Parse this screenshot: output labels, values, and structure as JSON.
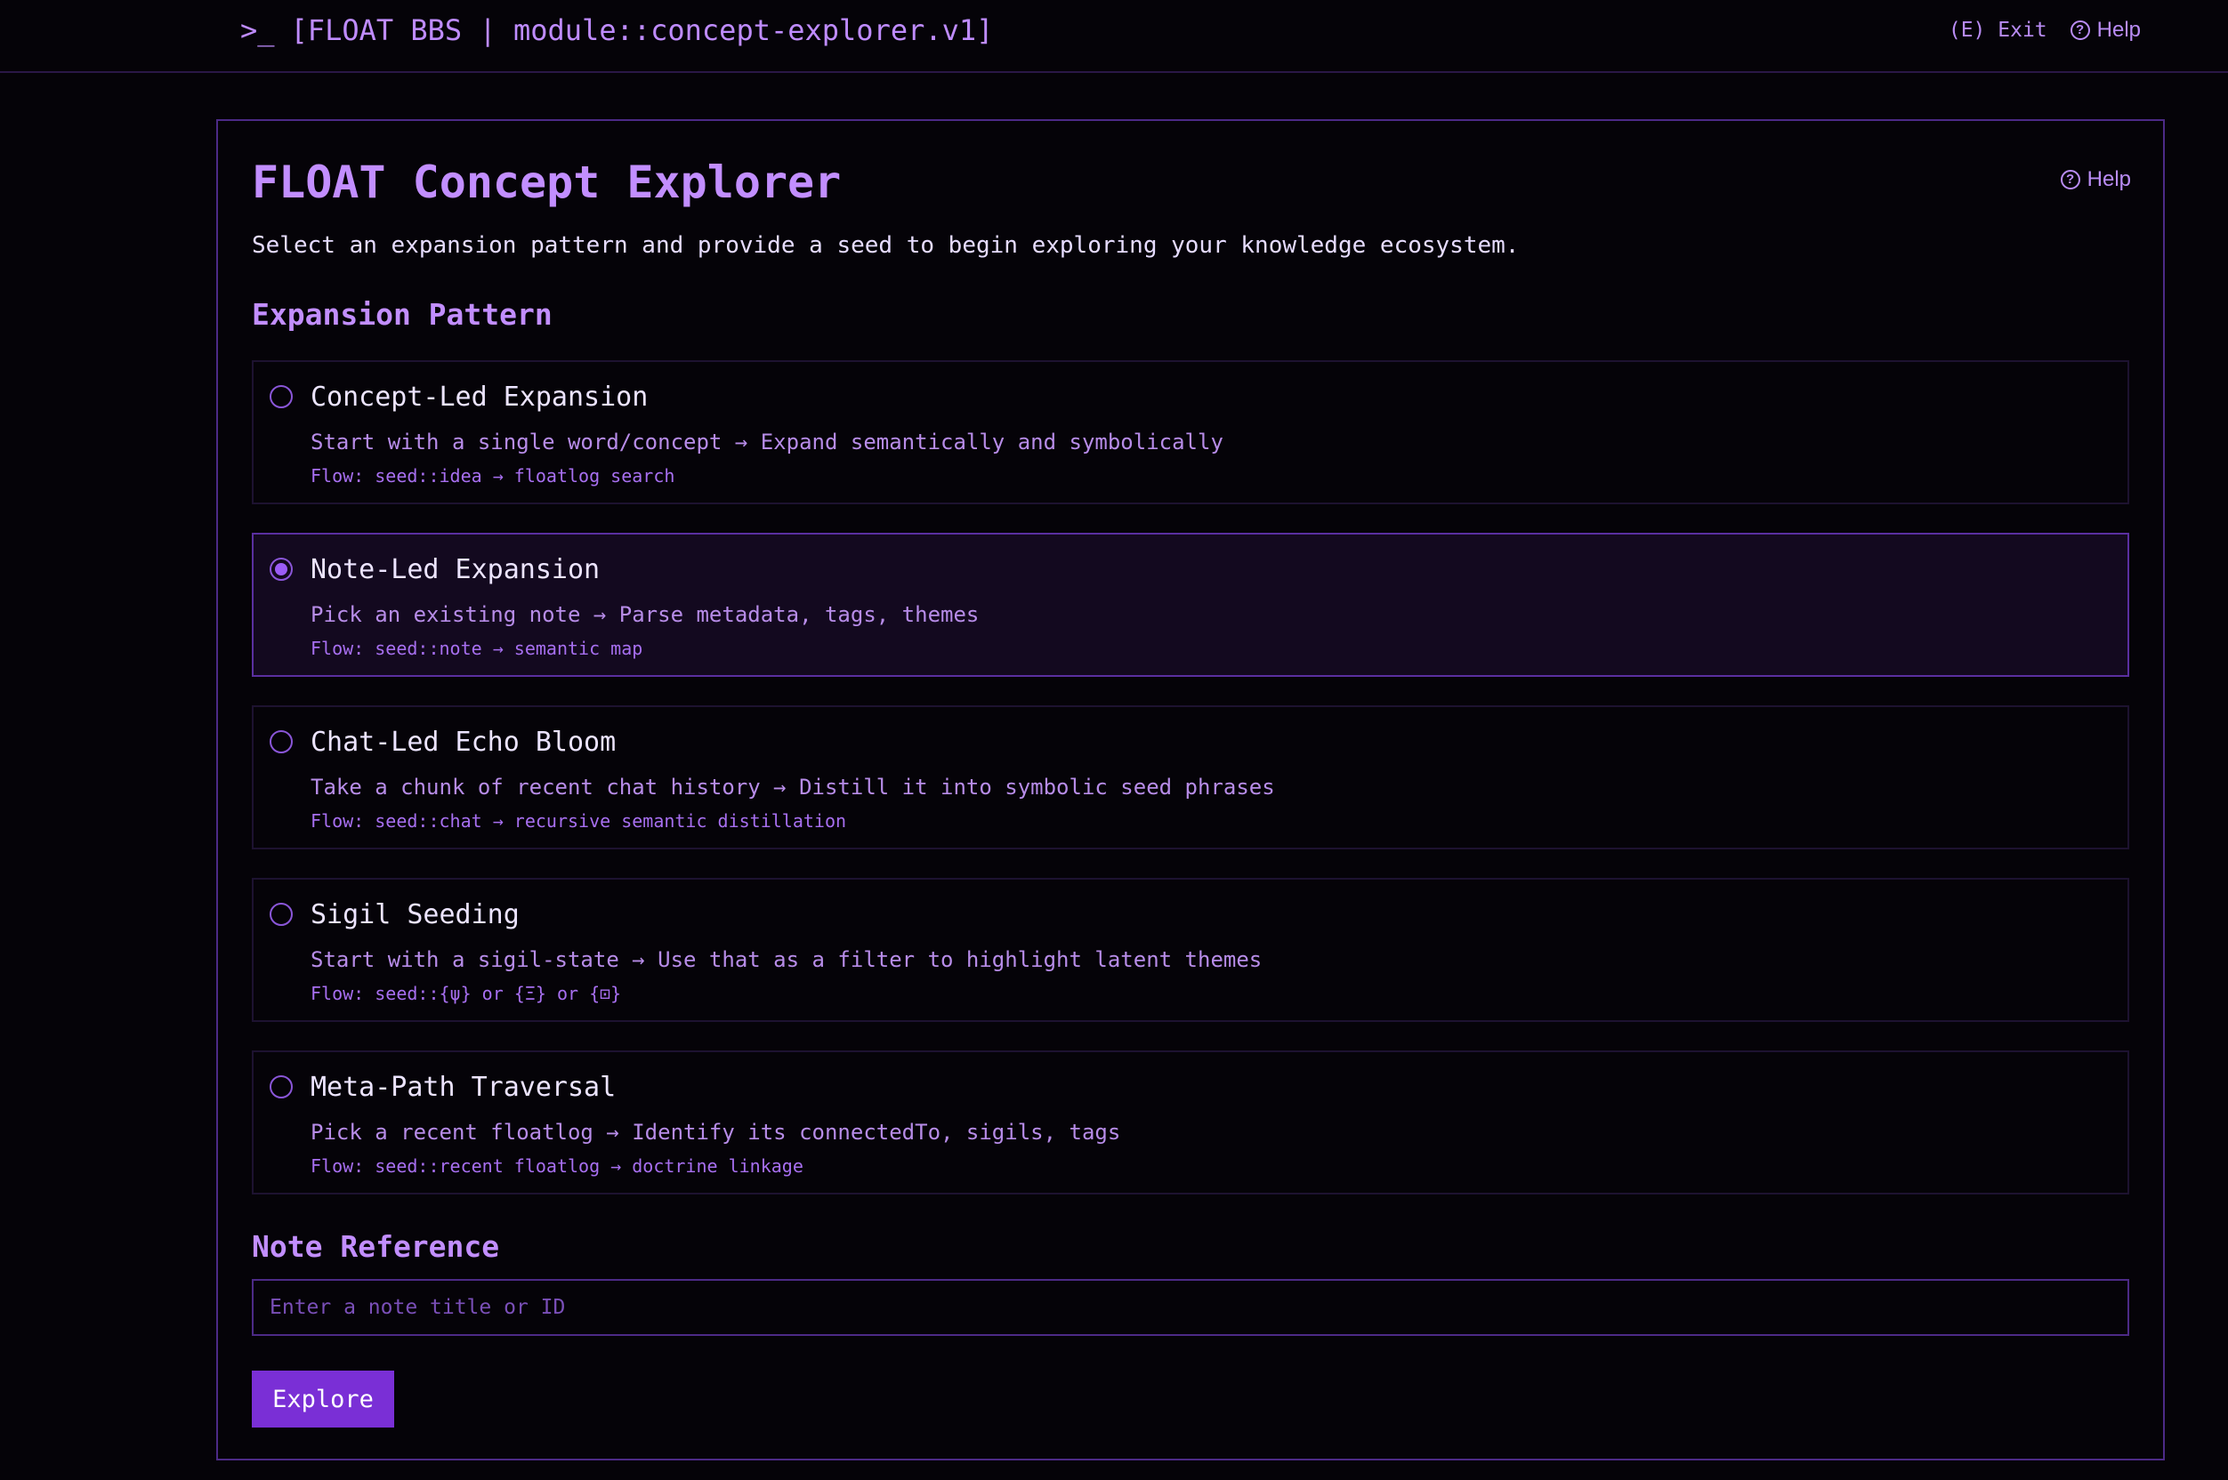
{
  "topbar": {
    "prompt": ">_",
    "title": "[FLOAT BBS | module::concept-explorer.v1]",
    "exit_label": "(E) Exit",
    "help_label": "Help"
  },
  "panel": {
    "title": "FLOAT Concept Explorer",
    "help_label": "Help",
    "subtitle": "Select an expansion pattern and provide a seed to begin exploring your knowledge ecosystem.",
    "expansion_heading": "Expansion Pattern",
    "options": [
      {
        "title": "Concept-Led Expansion",
        "description": "Start with a single word/concept → Expand semantically and symbolically",
        "flow": "Flow: seed::idea → floatlog search",
        "selected": false
      },
      {
        "title": "Note-Led Expansion",
        "description": "Pick an existing note → Parse metadata, tags, themes",
        "flow": "Flow: seed::note → semantic map",
        "selected": true
      },
      {
        "title": "Chat-Led Echo Bloom",
        "description": "Take a chunk of recent chat history → Distill it into symbolic seed phrases",
        "flow": "Flow: seed::chat → recursive semantic distillation",
        "selected": false
      },
      {
        "title": "Sigil Seeding",
        "description": "Start with a sigil-state → Use that as a filter to highlight latent themes",
        "flow": "Flow: seed::{ψ} or {Ξ} or {⊡}",
        "selected": false
      },
      {
        "title": "Meta-Path Traversal",
        "description": "Pick a recent floatlog → Identify its connectedTo, sigils, tags",
        "flow": "Flow: seed::recent floatlog → doctrine linkage",
        "selected": false
      }
    ],
    "note_heading": "Note Reference",
    "note_input": {
      "value": "",
      "placeholder": "Enter a note title or ID"
    },
    "explore_label": "Explore"
  },
  "colors": {
    "background": "#050308",
    "accent": "#c28eff",
    "border": "#4c2a86",
    "button": "#7a2fd6",
    "selected_bg": "#13091f"
  }
}
